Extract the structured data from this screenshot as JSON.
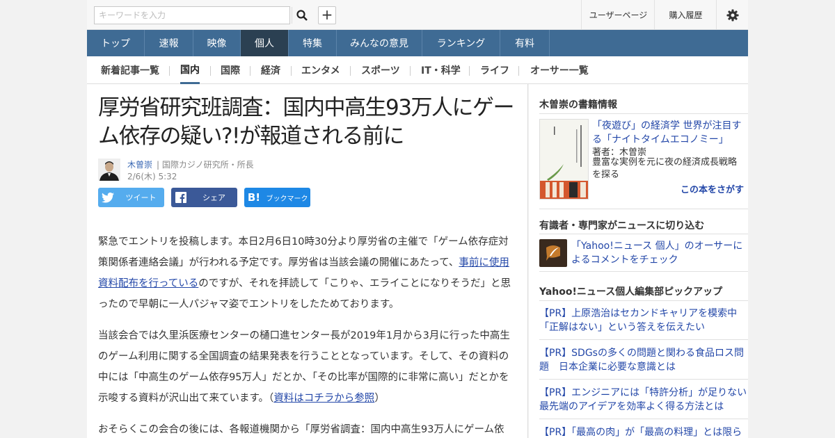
{
  "header": {
    "search_placeholder": "キーワードを入力",
    "user_page": "ユーザーページ",
    "purchase_history": "購入履歴"
  },
  "main_nav": [
    "トップ",
    "速報",
    "映像",
    "個人",
    "特集",
    "みんなの意見",
    "ランキング",
    "有料"
  ],
  "sub_nav": [
    "新着記事一覧",
    "国内",
    "国際",
    "経済",
    "エンタメ",
    "スポーツ",
    "IT・科学",
    "ライフ",
    "オーサー一覧"
  ],
  "article": {
    "title": "厚労省研究班調査：国内中高生93万人にゲーム依存の疑い?!が報道される前に",
    "author": "木曽崇",
    "affiliation": "| 国際カジノ研究所・所長",
    "date": "2/6(木) 5:32",
    "share": {
      "tweet": "ツイート",
      "facebook": "シェア",
      "bookmark": "ブックマーク"
    },
    "p1_before": "緊急でエントリを投稿します。本日2月6日10時30分より厚労省の主催で「ゲーム依存症対策関係者連絡会議」が行われる予定です。厚労省は当該会議の開催にあたって、",
    "p1_link": "事前に使用資料配布を行っている",
    "p1_after": "のですが、それを拝読して「こりゃ、エライことになりそうだ」と思ったので早朝に一人パジャマ姿でエントリをしたためております。",
    "p2_before": "当該会合では久里浜医療センターの樋口進センター長が2019年1月から3月に行った中高生のゲーム利用に関する全国調査の結果発表を行うこととなっています。そして、その資料の中には「中高生のゲーム依存95万人」だとか、「その比率が国際的に非常に高い」だとかを示唆する資料が沢山出て来ています。（",
    "p2_link": "資料はコチラから参照",
    "p2_after": "）",
    "p3": "おそらくこの会合の後には、各報道機関から「厚労省調査：国内中高生93万人にゲーム依"
  },
  "sidebar": {
    "book_heading": "木曽崇の書籍情報",
    "book_title": "「夜遊び」の経済学 世界が注目する「ナイトタイムエコノミー」",
    "book_author": "著者：木曽崇",
    "book_desc": "豊富な実例を元に夜の経済成長戦略を探る",
    "book_find": "この本をさがす",
    "expert_heading": "有識者・専門家がニュースに切り込む",
    "expert_text": "「Yahoo!ニュース 個人」のオーサーによるコメントをチェック",
    "pickup_heading": "Yahoo!ニュース個人編集部ピックアップ",
    "pickups": [
      "【PR】上原浩治はセカンドキャリアを模索中「正解はない」という答えを伝えたい",
      "【PR】SDGsの多くの問題と関わる食品ロス問題　日本企業に必要な意識とは",
      "【PR】エンジニアには「特許分析」が足りない最先端のアイデアを効率よく得る方法とは",
      "【PR】「最高の肉」が「最高の料理」とは限ら"
    ]
  }
}
